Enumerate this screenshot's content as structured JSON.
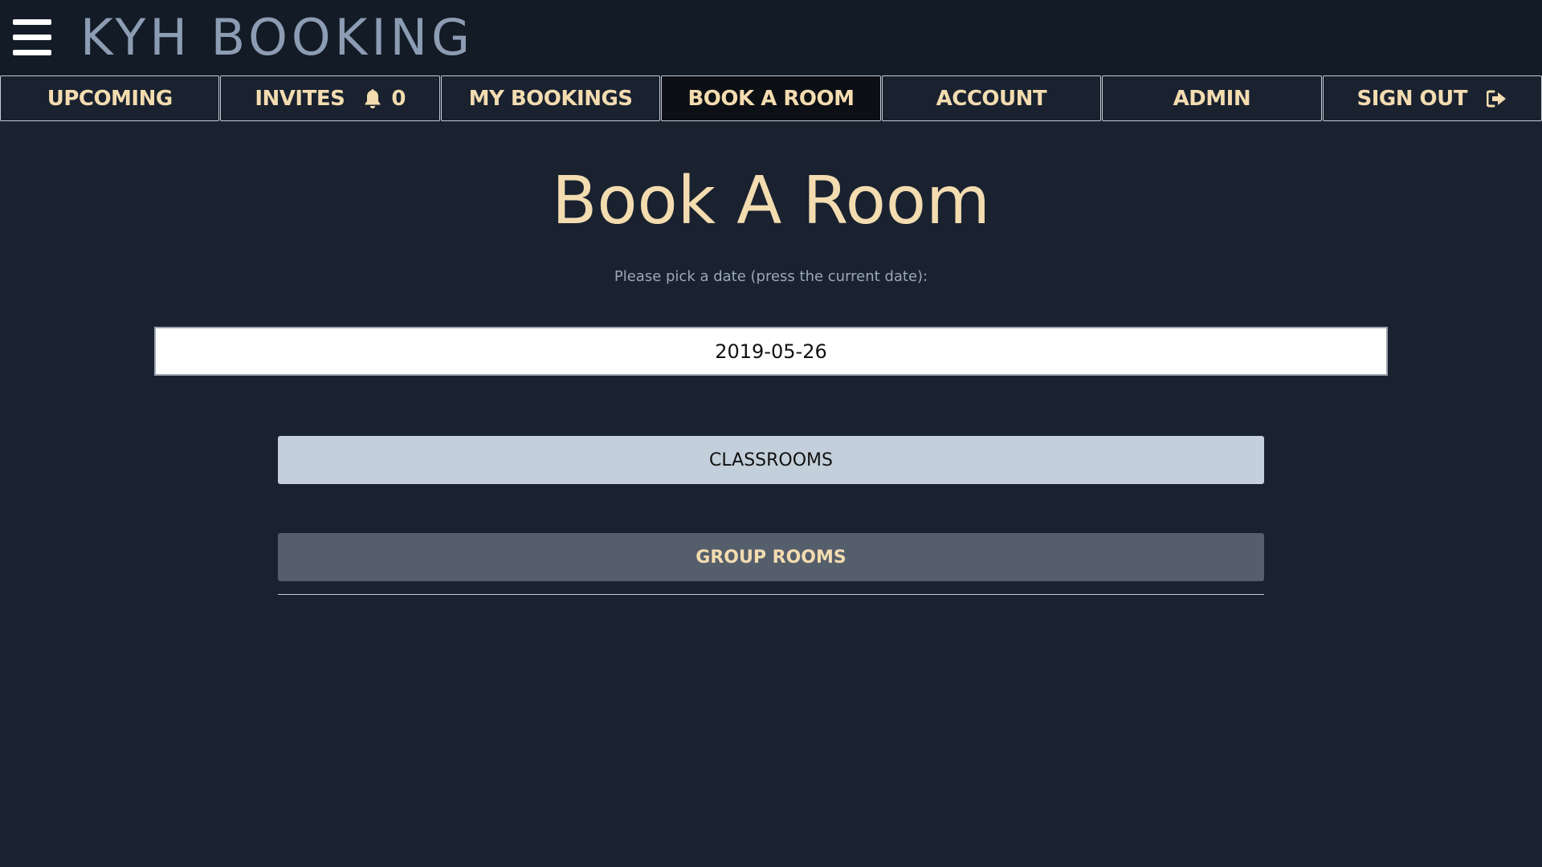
{
  "header": {
    "brand": "KYH BOOKING",
    "menu_icon": "hamburger-menu-icon"
  },
  "nav": {
    "items": [
      {
        "label": "UPCOMING"
      },
      {
        "label": "INVITES",
        "icon": "bell-icon",
        "count": "0"
      },
      {
        "label": "MY BOOKINGS"
      },
      {
        "label": "BOOK A ROOM",
        "active": true
      },
      {
        "label": "ACCOUNT"
      },
      {
        "label": "ADMIN"
      },
      {
        "label": "SIGN OUT",
        "icon": "sign-out-icon"
      }
    ]
  },
  "main": {
    "title": "Book A Room",
    "date_label": "Please pick a date (press the current date):",
    "date_value": "2019-05-26",
    "classrooms_label": "CLASSROOMS",
    "group_rooms_label": "GROUP ROOMS"
  },
  "colors": {
    "background": "#1a2230",
    "header": "#131b26",
    "accent_text": "#f3dcb0",
    "active_tab": "#0c0f14",
    "classrooms_button": "#c3cfda",
    "group_rooms_button": "#555e6b"
  }
}
